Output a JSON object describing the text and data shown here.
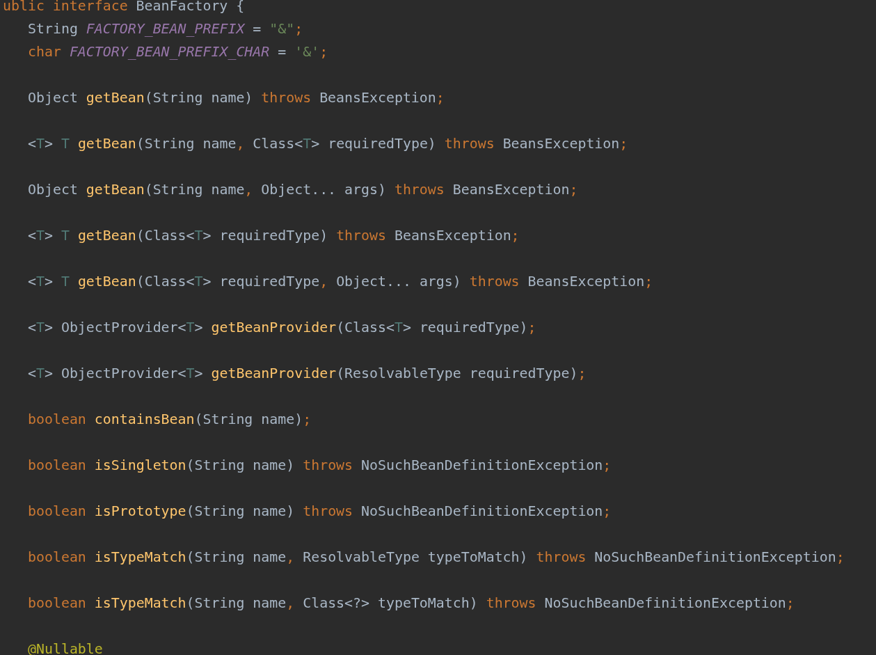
{
  "code_lines": [
    {
      "kind": "header",
      "tokens": [
        {
          "kind": "keyword",
          "text": "ublic interface"
        },
        {
          "kind": "plain",
          "text": " BeanFactory {"
        }
      ]
    },
    {
      "kind": "member",
      "tokens": [
        {
          "kind": "plain",
          "text": "String "
        },
        {
          "kind": "constant",
          "text": "FACTORY_BEAN_PREFIX"
        },
        {
          "kind": "plain",
          "text": " = "
        },
        {
          "kind": "string",
          "text": "\"&\""
        },
        {
          "kind": "punct",
          "text": ";"
        }
      ]
    },
    {
      "kind": "member",
      "tokens": [
        {
          "kind": "keyword",
          "text": "char "
        },
        {
          "kind": "constant",
          "text": "FACTORY_BEAN_PREFIX_CHAR"
        },
        {
          "kind": "plain",
          "text": " = "
        },
        {
          "kind": "string",
          "text": "'&'"
        },
        {
          "kind": "punct",
          "text": ";"
        }
      ]
    },
    {
      "kind": "blank"
    },
    {
      "kind": "member",
      "tokens": [
        {
          "kind": "plain",
          "text": "Object "
        },
        {
          "kind": "method",
          "text": "getBean"
        },
        {
          "kind": "plain",
          "text": "(String name) "
        },
        {
          "kind": "keyword",
          "text": "throws "
        },
        {
          "kind": "plain",
          "text": "BeansException"
        },
        {
          "kind": "punct",
          "text": ";"
        }
      ]
    },
    {
      "kind": "blank"
    },
    {
      "kind": "member",
      "tokens": [
        {
          "kind": "plain",
          "text": "<"
        },
        {
          "kind": "typeparam",
          "text": "T"
        },
        {
          "kind": "plain",
          "text": "> "
        },
        {
          "kind": "typeparam",
          "text": "T "
        },
        {
          "kind": "method",
          "text": "getBean"
        },
        {
          "kind": "plain",
          "text": "(String name"
        },
        {
          "kind": "punct",
          "text": ", "
        },
        {
          "kind": "plain",
          "text": "Class<"
        },
        {
          "kind": "typeparam",
          "text": "T"
        },
        {
          "kind": "plain",
          "text": "> requiredType) "
        },
        {
          "kind": "keyword",
          "text": "throws "
        },
        {
          "kind": "plain",
          "text": "BeansException"
        },
        {
          "kind": "punct",
          "text": ";"
        }
      ]
    },
    {
      "kind": "blank"
    },
    {
      "kind": "member",
      "tokens": [
        {
          "kind": "plain",
          "text": "Object "
        },
        {
          "kind": "method",
          "text": "getBean"
        },
        {
          "kind": "plain",
          "text": "(String name"
        },
        {
          "kind": "punct",
          "text": ", "
        },
        {
          "kind": "plain",
          "text": "Object... args) "
        },
        {
          "kind": "keyword",
          "text": "throws "
        },
        {
          "kind": "plain",
          "text": "BeansException"
        },
        {
          "kind": "punct",
          "text": ";"
        }
      ]
    },
    {
      "kind": "blank"
    },
    {
      "kind": "member",
      "tokens": [
        {
          "kind": "plain",
          "text": "<"
        },
        {
          "kind": "typeparam",
          "text": "T"
        },
        {
          "kind": "plain",
          "text": "> "
        },
        {
          "kind": "typeparam",
          "text": "T "
        },
        {
          "kind": "method",
          "text": "getBean"
        },
        {
          "kind": "plain",
          "text": "(Class<"
        },
        {
          "kind": "typeparam",
          "text": "T"
        },
        {
          "kind": "plain",
          "text": "> requiredType) "
        },
        {
          "kind": "keyword",
          "text": "throws "
        },
        {
          "kind": "plain",
          "text": "BeansException"
        },
        {
          "kind": "punct",
          "text": ";"
        }
      ]
    },
    {
      "kind": "blank"
    },
    {
      "kind": "member",
      "tokens": [
        {
          "kind": "plain",
          "text": "<"
        },
        {
          "kind": "typeparam",
          "text": "T"
        },
        {
          "kind": "plain",
          "text": "> "
        },
        {
          "kind": "typeparam",
          "text": "T "
        },
        {
          "kind": "method",
          "text": "getBean"
        },
        {
          "kind": "plain",
          "text": "(Class<"
        },
        {
          "kind": "typeparam",
          "text": "T"
        },
        {
          "kind": "plain",
          "text": "> requiredType"
        },
        {
          "kind": "punct",
          "text": ", "
        },
        {
          "kind": "plain",
          "text": "Object... args) "
        },
        {
          "kind": "keyword",
          "text": "throws "
        },
        {
          "kind": "plain",
          "text": "BeansException"
        },
        {
          "kind": "punct",
          "text": ";"
        }
      ]
    },
    {
      "kind": "blank"
    },
    {
      "kind": "member",
      "tokens": [
        {
          "kind": "plain",
          "text": "<"
        },
        {
          "kind": "typeparam",
          "text": "T"
        },
        {
          "kind": "plain",
          "text": "> ObjectProvider<"
        },
        {
          "kind": "typeparam",
          "text": "T"
        },
        {
          "kind": "plain",
          "text": "> "
        },
        {
          "kind": "method",
          "text": "getBeanProvider"
        },
        {
          "kind": "plain",
          "text": "(Class<"
        },
        {
          "kind": "typeparam",
          "text": "T"
        },
        {
          "kind": "plain",
          "text": "> requiredType)"
        },
        {
          "kind": "punct",
          "text": ";"
        }
      ]
    },
    {
      "kind": "blank"
    },
    {
      "kind": "member",
      "tokens": [
        {
          "kind": "plain",
          "text": "<"
        },
        {
          "kind": "typeparam",
          "text": "T"
        },
        {
          "kind": "plain",
          "text": "> ObjectProvider<"
        },
        {
          "kind": "typeparam",
          "text": "T"
        },
        {
          "kind": "plain",
          "text": "> "
        },
        {
          "kind": "method",
          "text": "getBeanProvider"
        },
        {
          "kind": "plain",
          "text": "(ResolvableType requiredType)"
        },
        {
          "kind": "punct",
          "text": ";"
        }
      ]
    },
    {
      "kind": "blank"
    },
    {
      "kind": "member",
      "tokens": [
        {
          "kind": "keyword",
          "text": "boolean "
        },
        {
          "kind": "method",
          "text": "containsBean"
        },
        {
          "kind": "plain",
          "text": "(String name)"
        },
        {
          "kind": "punct",
          "text": ";"
        }
      ]
    },
    {
      "kind": "blank"
    },
    {
      "kind": "member",
      "tokens": [
        {
          "kind": "keyword",
          "text": "boolean "
        },
        {
          "kind": "method",
          "text": "isSingleton"
        },
        {
          "kind": "plain",
          "text": "(String name) "
        },
        {
          "kind": "keyword",
          "text": "throws "
        },
        {
          "kind": "plain",
          "text": "NoSuchBeanDefinitionException"
        },
        {
          "kind": "punct",
          "text": ";"
        }
      ]
    },
    {
      "kind": "blank"
    },
    {
      "kind": "member",
      "tokens": [
        {
          "kind": "keyword",
          "text": "boolean "
        },
        {
          "kind": "method",
          "text": "isPrototype"
        },
        {
          "kind": "plain",
          "text": "(String name) "
        },
        {
          "kind": "keyword",
          "text": "throws "
        },
        {
          "kind": "plain",
          "text": "NoSuchBeanDefinitionException"
        },
        {
          "kind": "punct",
          "text": ";"
        }
      ]
    },
    {
      "kind": "blank"
    },
    {
      "kind": "member",
      "tokens": [
        {
          "kind": "keyword",
          "text": "boolean "
        },
        {
          "kind": "method",
          "text": "isTypeMatch"
        },
        {
          "kind": "plain",
          "text": "(String name"
        },
        {
          "kind": "punct",
          "text": ", "
        },
        {
          "kind": "plain",
          "text": "ResolvableType typeToMatch) "
        },
        {
          "kind": "keyword",
          "text": "throws "
        },
        {
          "kind": "plain",
          "text": "NoSuchBeanDefinitionException"
        },
        {
          "kind": "punct",
          "text": ";"
        }
      ]
    },
    {
      "kind": "blank"
    },
    {
      "kind": "member",
      "tokens": [
        {
          "kind": "keyword",
          "text": "boolean "
        },
        {
          "kind": "method",
          "text": "isTypeMatch"
        },
        {
          "kind": "plain",
          "text": "(String name"
        },
        {
          "kind": "punct",
          "text": ", "
        },
        {
          "kind": "plain",
          "text": "Class<?> typeToMatch) "
        },
        {
          "kind": "keyword",
          "text": "throws "
        },
        {
          "kind": "plain",
          "text": "NoSuchBeanDefinitionException"
        },
        {
          "kind": "punct",
          "text": ";"
        }
      ]
    },
    {
      "kind": "blank"
    },
    {
      "kind": "member",
      "tokens": [
        {
          "kind": "annotation",
          "text": "@Nullable"
        }
      ]
    }
  ]
}
